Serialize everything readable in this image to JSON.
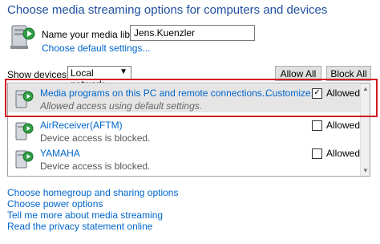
{
  "title": "Choose media streaming options for computers and devices",
  "library": {
    "label": "Name your media library:",
    "value": "Jens.Kuenzler",
    "default_link": "Choose default settings..."
  },
  "show_devices": {
    "label": "Show devices on:",
    "selected": "Local network"
  },
  "buttons": {
    "allow_all": "Allow All",
    "block_all": "Block All"
  },
  "devices": [
    {
      "name": "Media programs on this PC and remote connections...",
      "status": "Allowed access using default settings.",
      "customize": "Customize...",
      "allowed_label": "Allowed",
      "checked": true
    },
    {
      "name": "AirReceiver(AFTM)",
      "status": "Device access is blocked.",
      "allowed_label": "Allowed",
      "checked": false
    },
    {
      "name": "YAMAHA",
      "status": "Device access is blocked.",
      "allowed_label": "Allowed",
      "checked": false
    }
  ],
  "links": [
    "Choose homegroup and sharing options",
    "Choose power options",
    "Tell me more about media streaming",
    "Read the privacy statement online"
  ],
  "colors": {
    "title": "#1e4e9c",
    "link": "#0066cc",
    "highlight": "#d0191f"
  }
}
